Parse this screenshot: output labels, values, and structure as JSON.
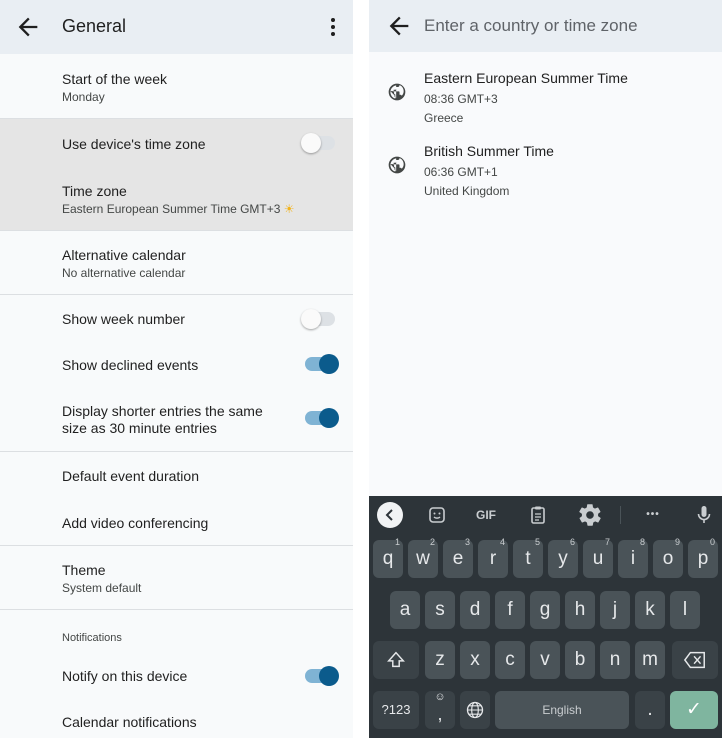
{
  "settings": {
    "title": "General",
    "rows": {
      "start_week": {
        "title": "Start of the week",
        "subtitle": "Monday"
      },
      "device_tz": {
        "title": "Use device's time zone"
      },
      "time_zone": {
        "title": "Time zone",
        "subtitle": "Eastern European Summer Time  GMT+3",
        "sun": "☀"
      },
      "alt_calendar": {
        "title": "Alternative calendar",
        "subtitle": "No alternative calendar"
      },
      "week_number": {
        "title": "Show week number"
      },
      "declined": {
        "title": "Show declined events"
      },
      "shorter_line1": "Display shorter entries the same",
      "shorter_line2": "size as 30 minute entries",
      "default_duration": {
        "title": "Default event duration"
      },
      "video_conf": {
        "title": "Add video conferencing"
      },
      "theme": {
        "title": "Theme",
        "subtitle": "System default"
      },
      "notifications_label": "Notifications",
      "notify_device": {
        "title": "Notify on this device"
      },
      "calendar_notifications": {
        "title": "Calendar notifications"
      }
    },
    "toggles": {
      "device_tz": false,
      "week_number": false,
      "declined": true,
      "shorter": true,
      "notify_device": true
    },
    "colors": {
      "accent": "#0b5b8c",
      "accent_track": "#7fb3d4",
      "appbar": "#e9eef3"
    }
  },
  "timezone_search": {
    "placeholder": "Enter a country or time zone",
    "results": [
      {
        "name": "Eastern European Summer Time",
        "time": "08:36  GMT+3",
        "country": "Greece",
        "icon": "globe-icon"
      },
      {
        "name": "British Summer Time",
        "time": "06:36  GMT+1",
        "country": "United Kingdom",
        "icon": "globe-icon"
      }
    ]
  },
  "keyboard": {
    "toolbar": {
      "gif": "GIF",
      "more": "•••"
    },
    "row1": [
      {
        "ch": "q",
        "num": "1"
      },
      {
        "ch": "w",
        "num": "2"
      },
      {
        "ch": "e",
        "num": "3"
      },
      {
        "ch": "r",
        "num": "4"
      },
      {
        "ch": "t",
        "num": "5"
      },
      {
        "ch": "y",
        "num": "6"
      },
      {
        "ch": "u",
        "num": "7"
      },
      {
        "ch": "i",
        "num": "8"
      },
      {
        "ch": "o",
        "num": "9"
      },
      {
        "ch": "p",
        "num": "0"
      }
    ],
    "row2": [
      "a",
      "s",
      "d",
      "f",
      "g",
      "h",
      "j",
      "k",
      "l"
    ],
    "row3": [
      "z",
      "x",
      "c",
      "v",
      "b",
      "n",
      "m"
    ],
    "symbols_label": "?123",
    "emoji_top": "☺",
    "comma": ",",
    "space_label": "English",
    "period": ".",
    "enter_label": "✓"
  }
}
